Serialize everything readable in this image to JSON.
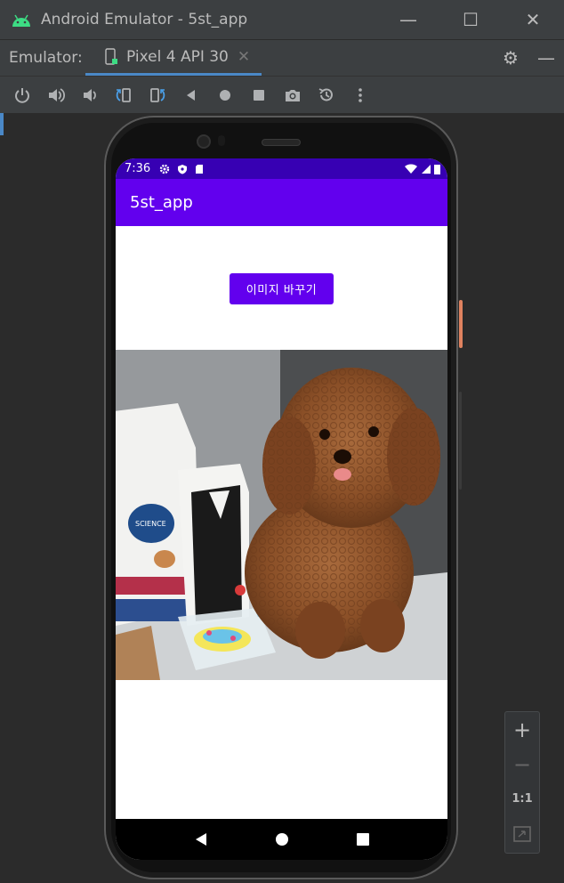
{
  "window": {
    "title": "Android Emulator - 5st_app",
    "minimize": "—",
    "maximize": "☐",
    "close": "✕"
  },
  "tabs": {
    "label": "Emulator:",
    "device_tab": "Pixel 4 API 30",
    "close_glyph": "✕",
    "settings_glyph": "⚙",
    "hide_glyph": "—"
  },
  "toolbar": {
    "items": [
      "power-icon",
      "volume-up-icon",
      "volume-down-icon",
      "rotate-left-icon",
      "rotate-right-icon",
      "back-icon",
      "home-icon",
      "overview-icon",
      "screenshot-icon",
      "snapshot-icon",
      "more-icon"
    ]
  },
  "status_bar": {
    "time": "7:36"
  },
  "app": {
    "title": "5st_app",
    "button_label": "이미지 바꾸기"
  },
  "zoom": {
    "zoom_in": "+",
    "zoom_out": "−",
    "actual_size": "1:1"
  },
  "colors": {
    "status_bar": "#3700b3",
    "app_bar": "#6200ee",
    "button": "#6200ee",
    "ide_background": "#3c3f41",
    "tab_underline": "#4a88c7"
  }
}
